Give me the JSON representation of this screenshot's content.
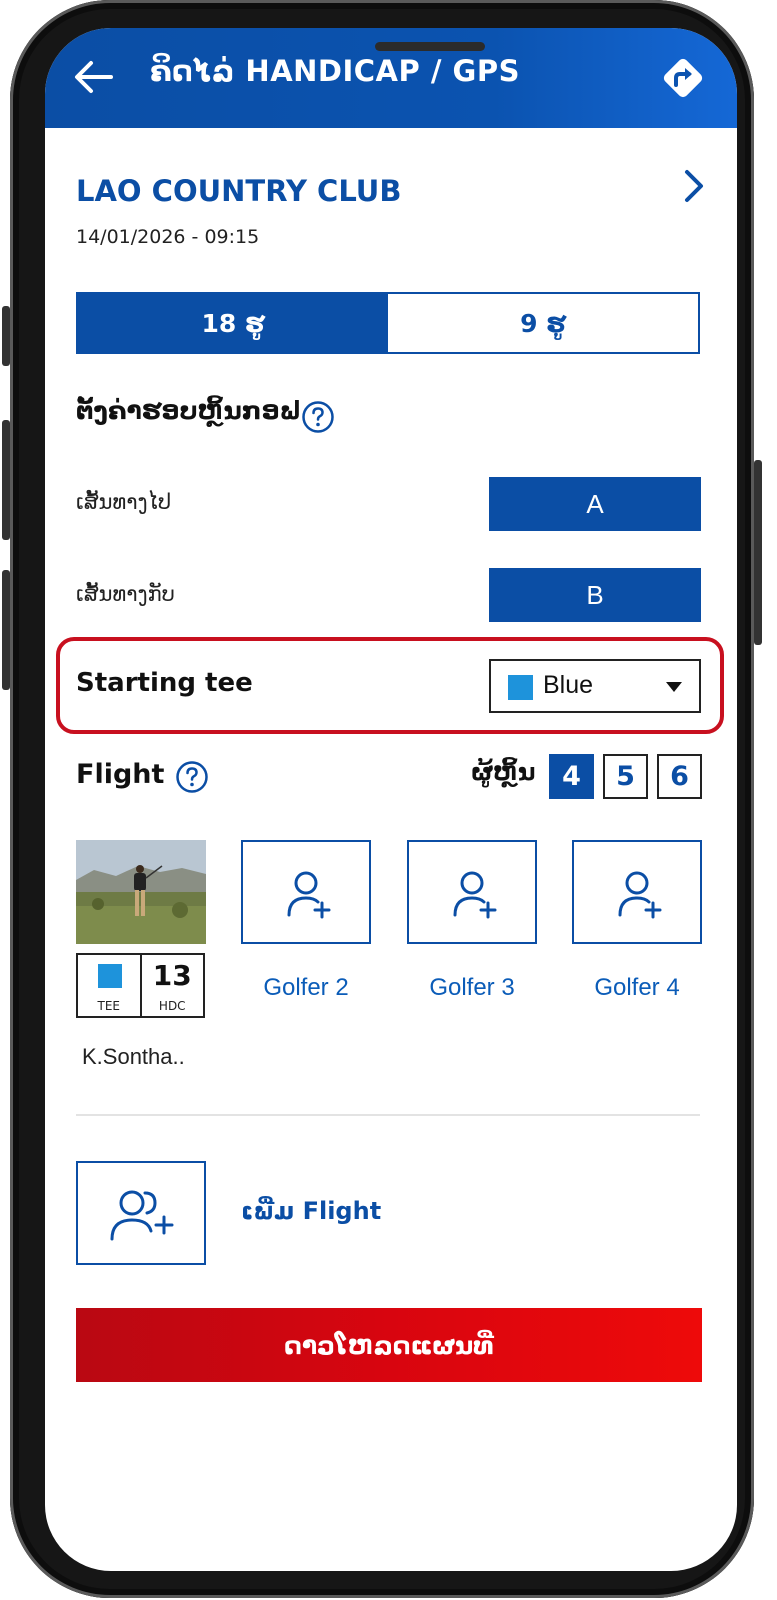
{
  "header": {
    "title": "ຄິດໄລ່ HANDICAP / GPS",
    "back_icon": "arrow-left-icon",
    "directions_icon": "directions-icon"
  },
  "club": {
    "name": "LAO COUNTRY CLUB",
    "datetime": "14/01/2026 - 09:15"
  },
  "holes": {
    "options": [
      "18 ຮູ",
      "9 ຮູ"
    ],
    "selected": "18 ຮູ"
  },
  "round_settings": {
    "title": "ຕັ້ງຄ່າຮອບຫຼິ້ນກອຟ",
    "outbound_label": "ເສັ້ນທາງໄປ",
    "outbound_value": "A",
    "return_label": "ເສັ້ນທາງກັບ",
    "return_value": "B",
    "starting_tee_label": "Starting tee",
    "starting_tee_value": "Blue",
    "starting_tee_color": "#1e93db"
  },
  "flight": {
    "label": "Flight",
    "players_label": "ຜູ້ຫຼິ້ນ",
    "counts": [
      "4",
      "5",
      "6"
    ],
    "selected_count": "4",
    "golfer1": {
      "tee_label": "TEE",
      "tee_color": "#1e93db",
      "hdc_value": "13",
      "hdc_label": "HDC",
      "name": "K.Sontha.."
    },
    "slots": [
      "Golfer 2",
      "Golfer 3",
      "Golfer 4"
    ],
    "add_flight_label": "ເພີ່ມ Flight"
  },
  "download_button": "ດາວໂຫລດແຜນທີ່",
  "colors": {
    "primary": "#0b4ea5",
    "accent_red": "#d8050f",
    "highlight_border": "#c8101f"
  }
}
